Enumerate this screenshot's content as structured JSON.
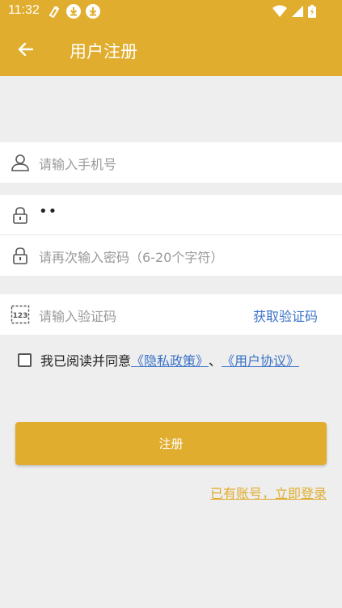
{
  "status_bar": {
    "time": "11:32",
    "left_icons": [
      "vpn-key-icon",
      "download-icon",
      "download-icon"
    ],
    "right_icons": [
      "wifi-icon",
      "signal-icon",
      "battery-icon"
    ]
  },
  "header": {
    "title": "用户注册",
    "back_icon": "arrow-left-icon",
    "color": "#e0ad2e"
  },
  "form": {
    "phone": {
      "icon": "user-icon",
      "placeholder": "请输入手机号",
      "value": ""
    },
    "password": {
      "icon": "lock-icon",
      "placeholder": "",
      "value": "••"
    },
    "confirm_password": {
      "icon": "lock-icon",
      "placeholder": "请再次输入密码（6-20个字符）",
      "value": ""
    },
    "verify_code": {
      "icon": "number-123-icon",
      "placeholder": "请输入验证码",
      "value": "",
      "get_code_label": "获取验证码"
    }
  },
  "agreement": {
    "checked": false,
    "prefix": "我已阅读并同意",
    "privacy_link": "《隐私政策》",
    "separator": "、",
    "user_agreement_link": "《用户协议》"
  },
  "actions": {
    "register_label": "注册",
    "login_link": "已有账号，立即登录"
  },
  "colors": {
    "accent": "#e0ad2e",
    "link": "#3b73c8",
    "background": "#eeeeee"
  }
}
